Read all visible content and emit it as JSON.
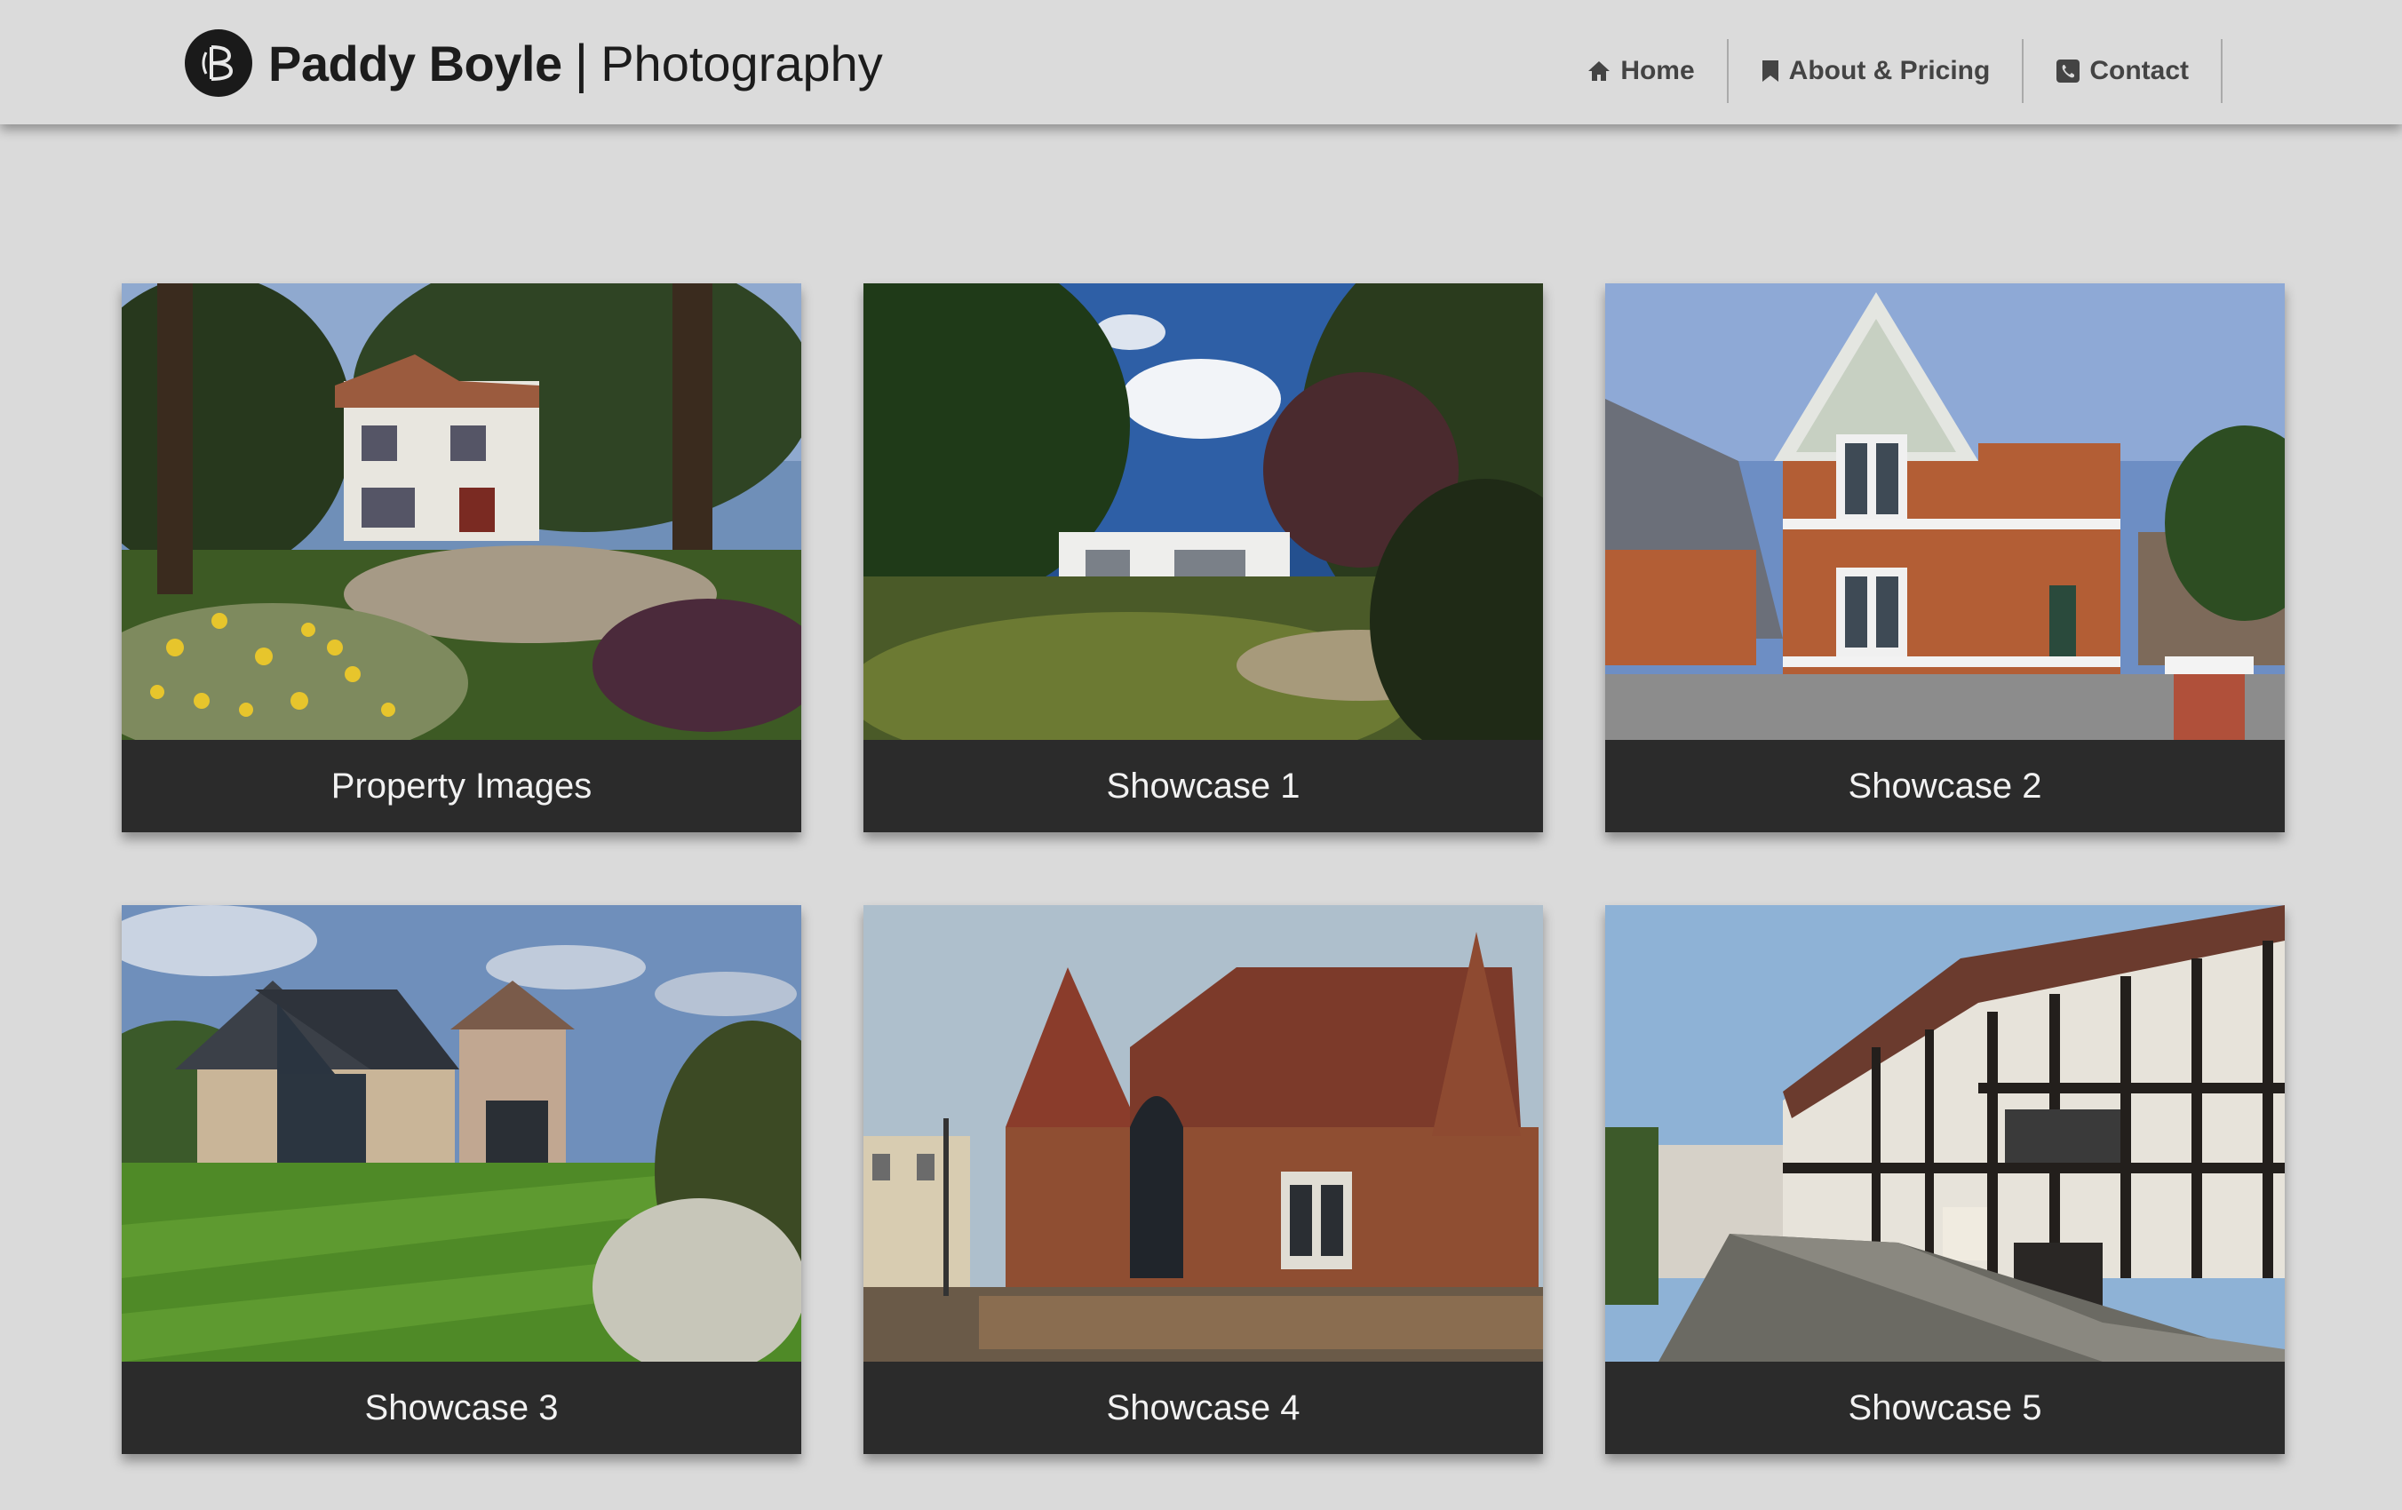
{
  "header": {
    "brand_name": "Paddy Boyle",
    "brand_separator": "|",
    "brand_sub": "Photography",
    "logo_icon": "pb-monogram-logo"
  },
  "nav": [
    {
      "label": "Home",
      "icon": "home-icon"
    },
    {
      "label": "About & Pricing",
      "icon": "bookmark-icon"
    },
    {
      "label": "Contact",
      "icon": "phone-icon"
    }
  ],
  "gallery": [
    {
      "caption": "Property Images"
    },
    {
      "caption": "Showcase 1"
    },
    {
      "caption": "Showcase 2"
    },
    {
      "caption": "Showcase 3"
    },
    {
      "caption": "Showcase 4"
    },
    {
      "caption": "Showcase 5"
    }
  ],
  "colors": {
    "background": "#dadada",
    "caption_bar": "#2b2b2b",
    "caption_text": "#f2f2f2",
    "nav_text": "#444444"
  }
}
